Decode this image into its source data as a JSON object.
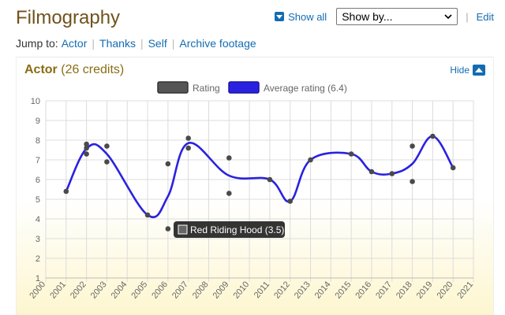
{
  "header": {
    "title": "Filmography",
    "show_all": "Show all",
    "show_by": "Show by...",
    "edit": "Edit"
  },
  "jump": {
    "label": "Jump to:",
    "links": [
      "Actor",
      "Thanks",
      "Self",
      "Archive footage"
    ]
  },
  "section": {
    "name": "Actor",
    "count": "(26 credits)",
    "hide": "Hide"
  },
  "tooltip": {
    "text": "Red Riding Hood (3.5)"
  },
  "colors": {
    "accent": "#136cb2",
    "section": "#8a6d14",
    "rating_dot": "#4a4a4a",
    "average_line": "#2a22e0"
  },
  "chart_data": {
    "type": "scatter",
    "ylim": [
      1,
      10
    ],
    "xlim": [
      2000,
      2021
    ],
    "y_ticks": [
      "1",
      "2",
      "3",
      "4",
      "5",
      "6",
      "7",
      "8",
      "9",
      "10"
    ],
    "x_ticks": [
      "2000",
      "2001",
      "2002",
      "2003",
      "2004",
      "2005",
      "2006",
      "2007",
      "2008",
      "2009",
      "2010",
      "2011",
      "2012",
      "2013",
      "2014",
      "2015",
      "2016",
      "2017",
      "2018",
      "2019",
      "2020",
      "2021"
    ],
    "legend": [
      {
        "name": "Rating",
        "kind": "box",
        "color": "#555555"
      },
      {
        "name": "Average rating (6.4)",
        "kind": "box",
        "color": "#2a22e0"
      }
    ],
    "series": [
      {
        "name": "Rating",
        "points": [
          [
            2001,
            5.4
          ],
          [
            2002,
            7.8
          ],
          [
            2002,
            7.6
          ],
          [
            2002,
            7.3
          ],
          [
            2003,
            7.7
          ],
          [
            2003,
            6.9
          ],
          [
            2005,
            4.2
          ],
          [
            2006,
            6.8
          ],
          [
            2006,
            3.5
          ],
          [
            2007,
            8.1
          ],
          [
            2007,
            7.6
          ],
          [
            2009,
            7.1
          ],
          [
            2009,
            5.3
          ],
          [
            2011,
            6.0
          ],
          [
            2012,
            4.9
          ],
          [
            2013,
            7.0
          ],
          [
            2015,
            7.3
          ],
          [
            2016,
            6.4
          ],
          [
            2017,
            6.3
          ],
          [
            2018,
            7.7
          ],
          [
            2018,
            5.9
          ],
          [
            2019,
            8.2
          ],
          [
            2020,
            6.6
          ]
        ]
      },
      {
        "name": "Average rating (6.4)",
        "points": [
          [
            2001,
            5.4
          ],
          [
            2002,
            7.57
          ],
          [
            2003,
            7.3
          ],
          [
            2005,
            4.2
          ],
          [
            2006,
            5.15
          ],
          [
            2007,
            7.85
          ],
          [
            2009,
            6.2
          ],
          [
            2011,
            6.0
          ],
          [
            2012,
            4.9
          ],
          [
            2013,
            7.0
          ],
          [
            2015,
            7.3
          ],
          [
            2016,
            6.4
          ],
          [
            2017,
            6.3
          ],
          [
            2018,
            6.8
          ],
          [
            2019,
            8.2
          ],
          [
            2020,
            6.6
          ]
        ]
      }
    ]
  }
}
